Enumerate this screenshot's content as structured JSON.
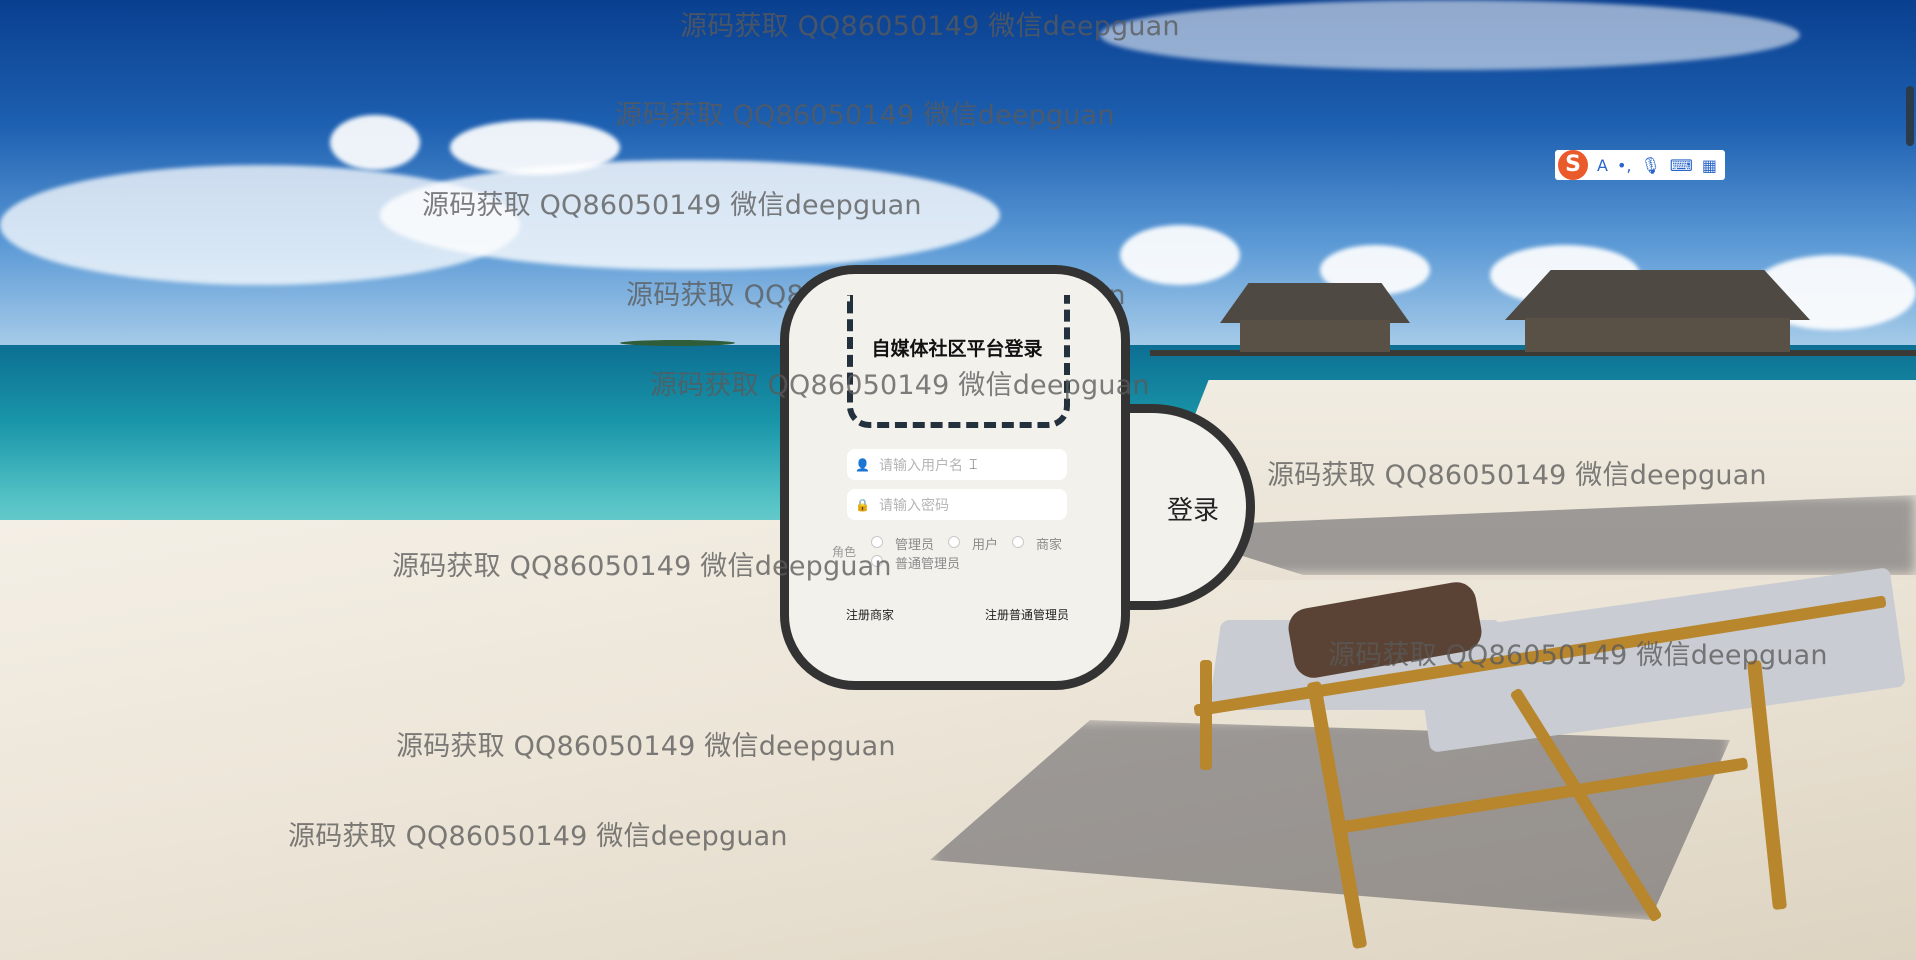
{
  "watermark": {
    "text": "源码获取 QQ86050149 微信deepguan"
  },
  "login": {
    "title": "自媒体社区平台登录",
    "username_placeholder": "请输入用户名",
    "password_placeholder": "请输入密码",
    "role_label": "角色",
    "roles": [
      "管理员",
      "用户",
      "商家",
      "普通管理员"
    ],
    "register_merchant": "注册商家",
    "register_admin": "注册普通管理员",
    "login_button": "登录"
  },
  "ime_toolbar": {
    "logo": "S",
    "items": [
      "A",
      "punctuation-icon",
      "mic-icon",
      "keyboard-icon",
      "grid-icon"
    ]
  },
  "colors": {
    "card_bg": "#f3f1ec",
    "card_border": "#333333",
    "title_border": "#23313d",
    "ime_logo": "#ea5a2a"
  }
}
